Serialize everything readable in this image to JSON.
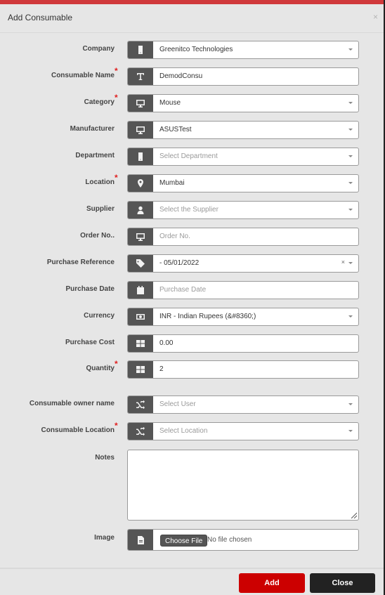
{
  "modal": {
    "title": "Add Consumable",
    "close_glyph": "×"
  },
  "fields": [
    {
      "id": "company",
      "label": "Company",
      "required": false,
      "icon": "building-icon",
      "type": "select",
      "value": "Greenitco Technologies",
      "placeholder": false
    },
    {
      "id": "consumable-name",
      "label": "Consumable Name",
      "required": true,
      "icon": "text-icon",
      "type": "text",
      "value": "DemodConsu",
      "placeholder": false
    },
    {
      "id": "category",
      "label": "Category",
      "required": true,
      "icon": "monitor-icon",
      "type": "select",
      "value": "Mouse",
      "placeholder": false
    },
    {
      "id": "manufacturer",
      "label": "Manufacturer",
      "required": false,
      "icon": "monitor-icon",
      "type": "select",
      "value": "ASUSTest",
      "placeholder": false
    },
    {
      "id": "department",
      "label": "Department",
      "required": false,
      "icon": "building-icon",
      "type": "select",
      "value": "Select Department",
      "placeholder": true
    },
    {
      "id": "location",
      "label": "Location",
      "required": true,
      "icon": "map-marker-icon",
      "type": "select",
      "value": "Mumbai",
      "placeholder": false
    },
    {
      "id": "supplier",
      "label": "Supplier",
      "required": false,
      "icon": "user-icon",
      "type": "select",
      "value": "Select the Supplier",
      "placeholder": true
    },
    {
      "id": "order-no",
      "label": "Order No..",
      "required": false,
      "icon": "monitor-icon",
      "type": "text",
      "value": "Order No.",
      "placeholder": true
    },
    {
      "id": "purchase-reference",
      "label": "Purchase Reference",
      "required": false,
      "icon": "tag-icon",
      "type": "select-clearable",
      "value": "- 05/01/2022",
      "placeholder": false
    },
    {
      "id": "purchase-date",
      "label": "Purchase Date",
      "required": false,
      "icon": "calendar-icon",
      "type": "text",
      "value": "Purchase Date",
      "placeholder": true
    },
    {
      "id": "currency",
      "label": "Currency",
      "required": false,
      "icon": "money-icon",
      "type": "select",
      "value": "INR - Indian Rupees (&#8360;)",
      "placeholder": false
    },
    {
      "id": "purchase-cost",
      "label": "Purchase Cost",
      "required": false,
      "icon": "grid-icon",
      "type": "text",
      "value": "0.00",
      "placeholder": false
    },
    {
      "id": "quantity",
      "label": "Quantity",
      "required": true,
      "icon": "grid-icon",
      "type": "text",
      "value": "2",
      "placeholder": false
    },
    {
      "id": "consumable-owner-name",
      "label": "Consumable owner name",
      "required": false,
      "icon": "shuffle-icon",
      "type": "select",
      "value": "Select User",
      "placeholder": true
    },
    {
      "id": "consumable-location",
      "label": "Consumable Location",
      "required": true,
      "icon": "shuffle-icon",
      "type": "select",
      "value": "Select Location",
      "placeholder": true
    }
  ],
  "notes": {
    "label": "Notes",
    "value": ""
  },
  "image": {
    "label": "Image",
    "button": "Choose File",
    "status": "No file chosen"
  },
  "footer": {
    "add_label": "Add",
    "close_label": "Close"
  },
  "colors": {
    "accent": "#cc0000",
    "top_bar": "#d0393b",
    "addon": "#555555",
    "close_button": "#222222",
    "required_star": "#e02020"
  }
}
